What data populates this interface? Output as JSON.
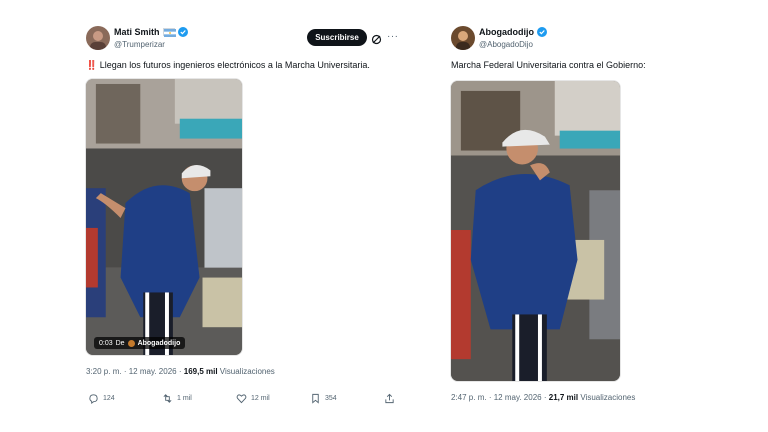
{
  "tweets": [
    {
      "display_name": "Mati Smith",
      "flag": "argentina-flag-icon",
      "handle": "@Trumperizar",
      "subscribe_label": "Suscribirse",
      "text": "Llegan los futuros ingenieros electrónicos a la Marcha Universitaria.",
      "text_prefix_emoji": "‼️",
      "video": {
        "duration": "0:03",
        "from_label": "De",
        "from_name": "Abogadodijo"
      },
      "time": "3:20 p. m.",
      "separator": "·",
      "date": "12 may. 2026",
      "views_count": "169,5 mil",
      "views_label": "Visualizaciones",
      "actions": {
        "replies": "124",
        "reposts": "1 mil",
        "likes": "12 mil",
        "bookmarks": "354"
      }
    },
    {
      "display_name": "Abogadodijo",
      "handle": "@AbogadoDijo",
      "text": "Marcha Federal Universitaria contra el Gobierno:",
      "time": "2:47 p. m.",
      "separator": "·",
      "date": "12 may. 2026",
      "views_count": "21,7 mil",
      "views_label": "Visualizaciones"
    }
  ],
  "colors": {
    "text_primary": "#0f1419",
    "text_secondary": "#536471",
    "verified_blue": "#1d9bf0",
    "jacket_blue": "#1f3f86",
    "cap_white": "#e8e8e8"
  }
}
